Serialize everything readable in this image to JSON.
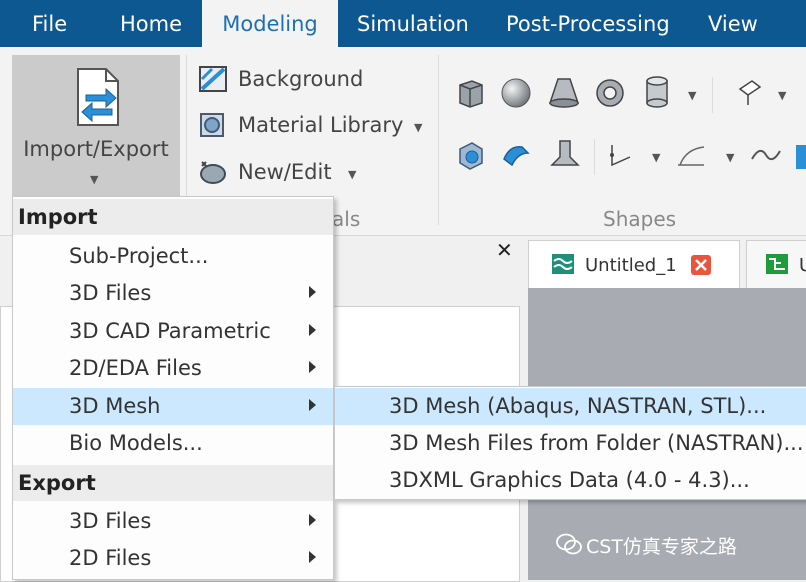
{
  "menubar": {
    "tabs": [
      "File",
      "Home",
      "Modeling",
      "Simulation",
      "Post-Processing",
      "View"
    ],
    "active_tab": "Modeling"
  },
  "ribbon": {
    "import_export_label": "Import/Export",
    "background_label": "Background",
    "material_library_label": "Material Library",
    "new_edit_label": "New/Edit",
    "materials_group_label": "Materials",
    "materials_group_partial": "als",
    "shapes_group_label": "Shapes"
  },
  "import_menu": {
    "import_header": "Import",
    "items": [
      "Sub-Project...",
      "3D Files",
      "3D CAD Parametric",
      "2D/EDA Files",
      "3D Mesh",
      "Bio Models..."
    ],
    "export_header": "Export",
    "export_items": [
      "3D Files",
      "2D Files"
    ]
  },
  "mesh_submenu": {
    "items": [
      "3D Mesh (Abaqus, NASTRAN, STL)...",
      "3D Mesh Files from Folder (NASTRAN)...",
      "3DXML Graphics Data (4.0 - 4.3)..."
    ]
  },
  "documents": {
    "tab1_label": "Untitled_1",
    "tab2_partial": "U"
  },
  "watermark": "CST仿真专家之路",
  "colors": {
    "menubar": "#0e5891",
    "active_tab_text": "#1f6fb3",
    "highlight": "#cce8ff"
  }
}
